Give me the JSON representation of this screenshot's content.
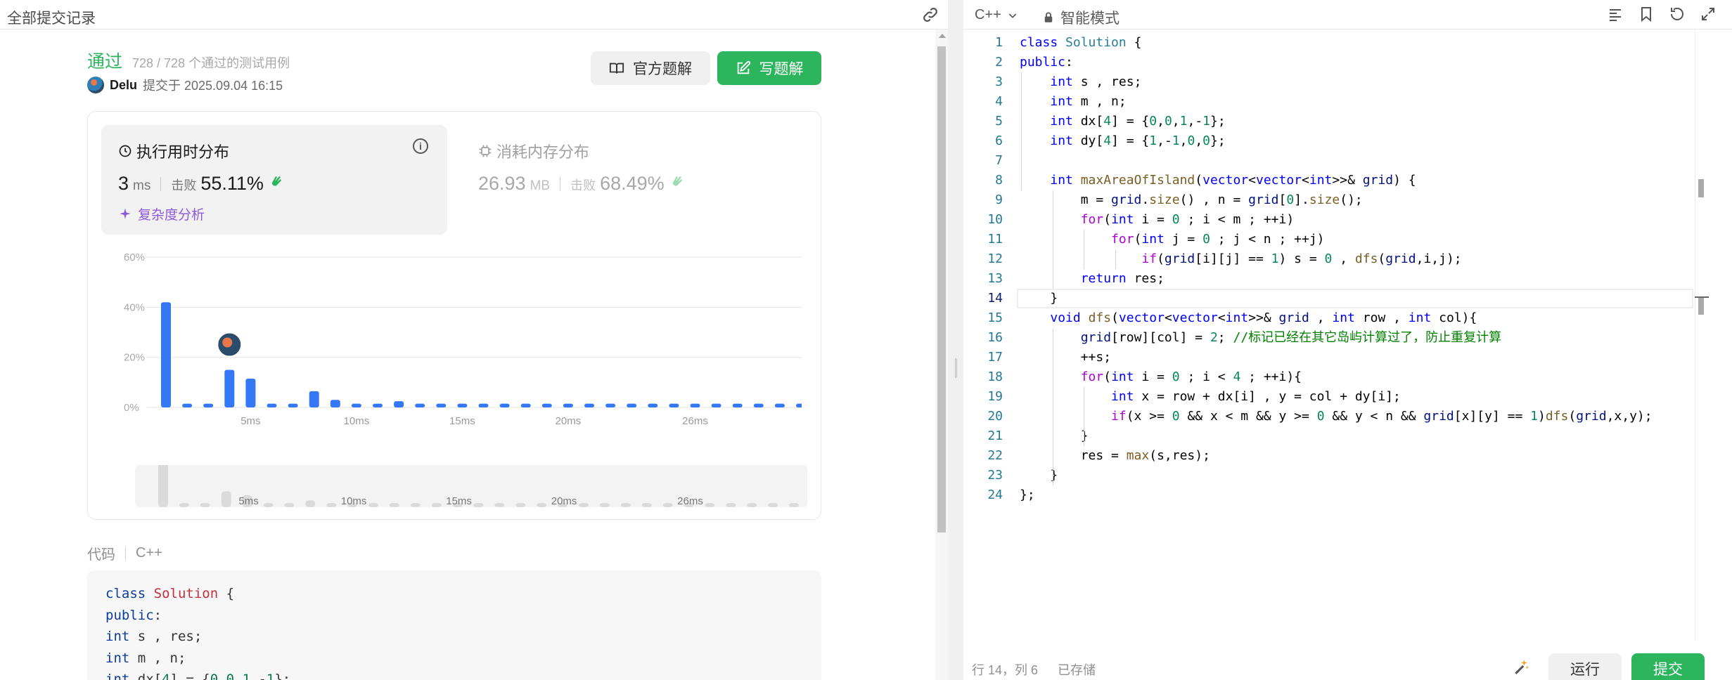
{
  "left_header": {
    "title": "全部提交记录",
    "link_icon": "link-icon"
  },
  "submission": {
    "status": "通过",
    "cases": "728 / 728 个通过的测试用例",
    "author": "Delu",
    "submitted_at": "提交于 2025.09.04 16:15"
  },
  "buttons": {
    "official": "官方题解",
    "write": "写题解"
  },
  "runtime": {
    "title": "执行用时分布",
    "value": "3",
    "unit": "ms",
    "beat_label": "击败",
    "beat_pct": "55.11%",
    "complexity": "复杂度分析"
  },
  "memory": {
    "title": "消耗内存分布",
    "value": "26.93",
    "unit": "MB",
    "beat_label": "击败",
    "beat_pct": "68.49%"
  },
  "chart_data": {
    "type": "bar",
    "ylabel": "",
    "xlabel": "",
    "y_ticks": [
      "60%",
      "40%",
      "20%",
      "0%"
    ],
    "ylim": [
      0,
      60
    ],
    "x_tick_labels": [
      "5ms",
      "10ms",
      "15ms",
      "20ms",
      "26ms"
    ],
    "x_tick_positions": [
      5,
      10,
      15,
      20,
      26
    ],
    "grid": true,
    "x": [
      1,
      2,
      3,
      4,
      5,
      6,
      7,
      8,
      9,
      10,
      11,
      12,
      13,
      14,
      15,
      16,
      17,
      18,
      19,
      20,
      21,
      22,
      23,
      24,
      25,
      26,
      27,
      28,
      29,
      30,
      31
    ],
    "values": [
      42,
      1.5,
      1.5,
      15,
      11.5,
      1.5,
      1.5,
      6.5,
      3,
      1.5,
      1.5,
      2.5,
      1.5,
      1.5,
      1.5,
      1.5,
      1.5,
      1.5,
      1.5,
      1.5,
      1.5,
      1.5,
      1.5,
      1.5,
      1.5,
      1.5,
      1.5,
      1.5,
      1.5,
      1.5,
      1.5
    ],
    "marker_at": 4,
    "bar_color": "#3478f6",
    "minimap_labels": [
      "5ms",
      "10ms",
      "15ms",
      "20ms",
      "26ms"
    ]
  },
  "code_section": {
    "label": "代码",
    "lang": "C++",
    "preview": [
      "class Solution {",
      "public:",
      "    int s , res;",
      "    int m , n;",
      "    int dx[4] = {0,0,1,-1};"
    ]
  },
  "editor": {
    "lang": "C++",
    "mode": "智能模式",
    "lines": [
      "class Solution {",
      "public:",
      "    int s , res;",
      "    int m , n;",
      "    int dx[4] = {0,0,1,-1};",
      "    int dy[4] = {1,-1,0,0};",
      "",
      "    int maxAreaOfIsland(vector<vector<int>>& grid) {",
      "        m = grid.size() , n = grid[0].size();",
      "        for(int i = 0 ; i < m ; ++i)",
      "            for(int j = 0 ; j < n ; ++j)",
      "                if(grid[i][j] == 1) s = 0 , dfs(grid,i,j);",
      "        return res;",
      "    }",
      "    void dfs(vector<vector<int>>& grid , int row , int col){",
      "        grid[row][col] = 2; //标记已经在其它岛屿计算过了，防止重复计算",
      "        ++s;",
      "        for(int i = 0 ; i < 4 ; ++i){",
      "            int x = row + dx[i] , y = col + dy[i];",
      "            if(x >= 0 && x < m && y >= 0 && y < n && grid[x][y] == 1)dfs(grid,x,y);",
      "        }",
      "        res = max(s,res);",
      "    }",
      "};"
    ],
    "current_line": 14
  },
  "footer": {
    "position": "行 14，列 6",
    "saved": "已存储",
    "run": "运行",
    "submit": "提交"
  },
  "colors": {
    "accent_green": "#2db55d",
    "bar_blue": "#3478f6",
    "purple": "#8e5bd8"
  }
}
